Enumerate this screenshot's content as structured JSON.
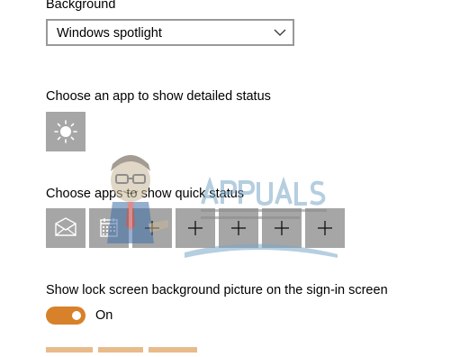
{
  "background": {
    "label": "Background",
    "selected": "Windows spotlight"
  },
  "detailed_status": {
    "label": "Choose an app to show detailed status",
    "tile_icon": "sun-brightness-icon"
  },
  "quick_status": {
    "label": "Choose apps to show quick status",
    "tiles": [
      {
        "icon": "mail-icon"
      },
      {
        "icon": "calendar-icon"
      },
      {
        "icon": "plus-icon"
      },
      {
        "icon": "plus-icon"
      },
      {
        "icon": "plus-icon"
      },
      {
        "icon": "plus-icon"
      },
      {
        "icon": "plus-icon"
      }
    ]
  },
  "signin_background": {
    "label": "Show lock screen background picture on the sign-in screen",
    "state_text": "On",
    "enabled": true
  },
  "colors": {
    "accent": "#d7812a",
    "tile": "#a6a6a6"
  },
  "watermark": {
    "brand": "APPUALS",
    "tagline": "TECH HOW-TO'S FROM THE EXPERTS!"
  }
}
